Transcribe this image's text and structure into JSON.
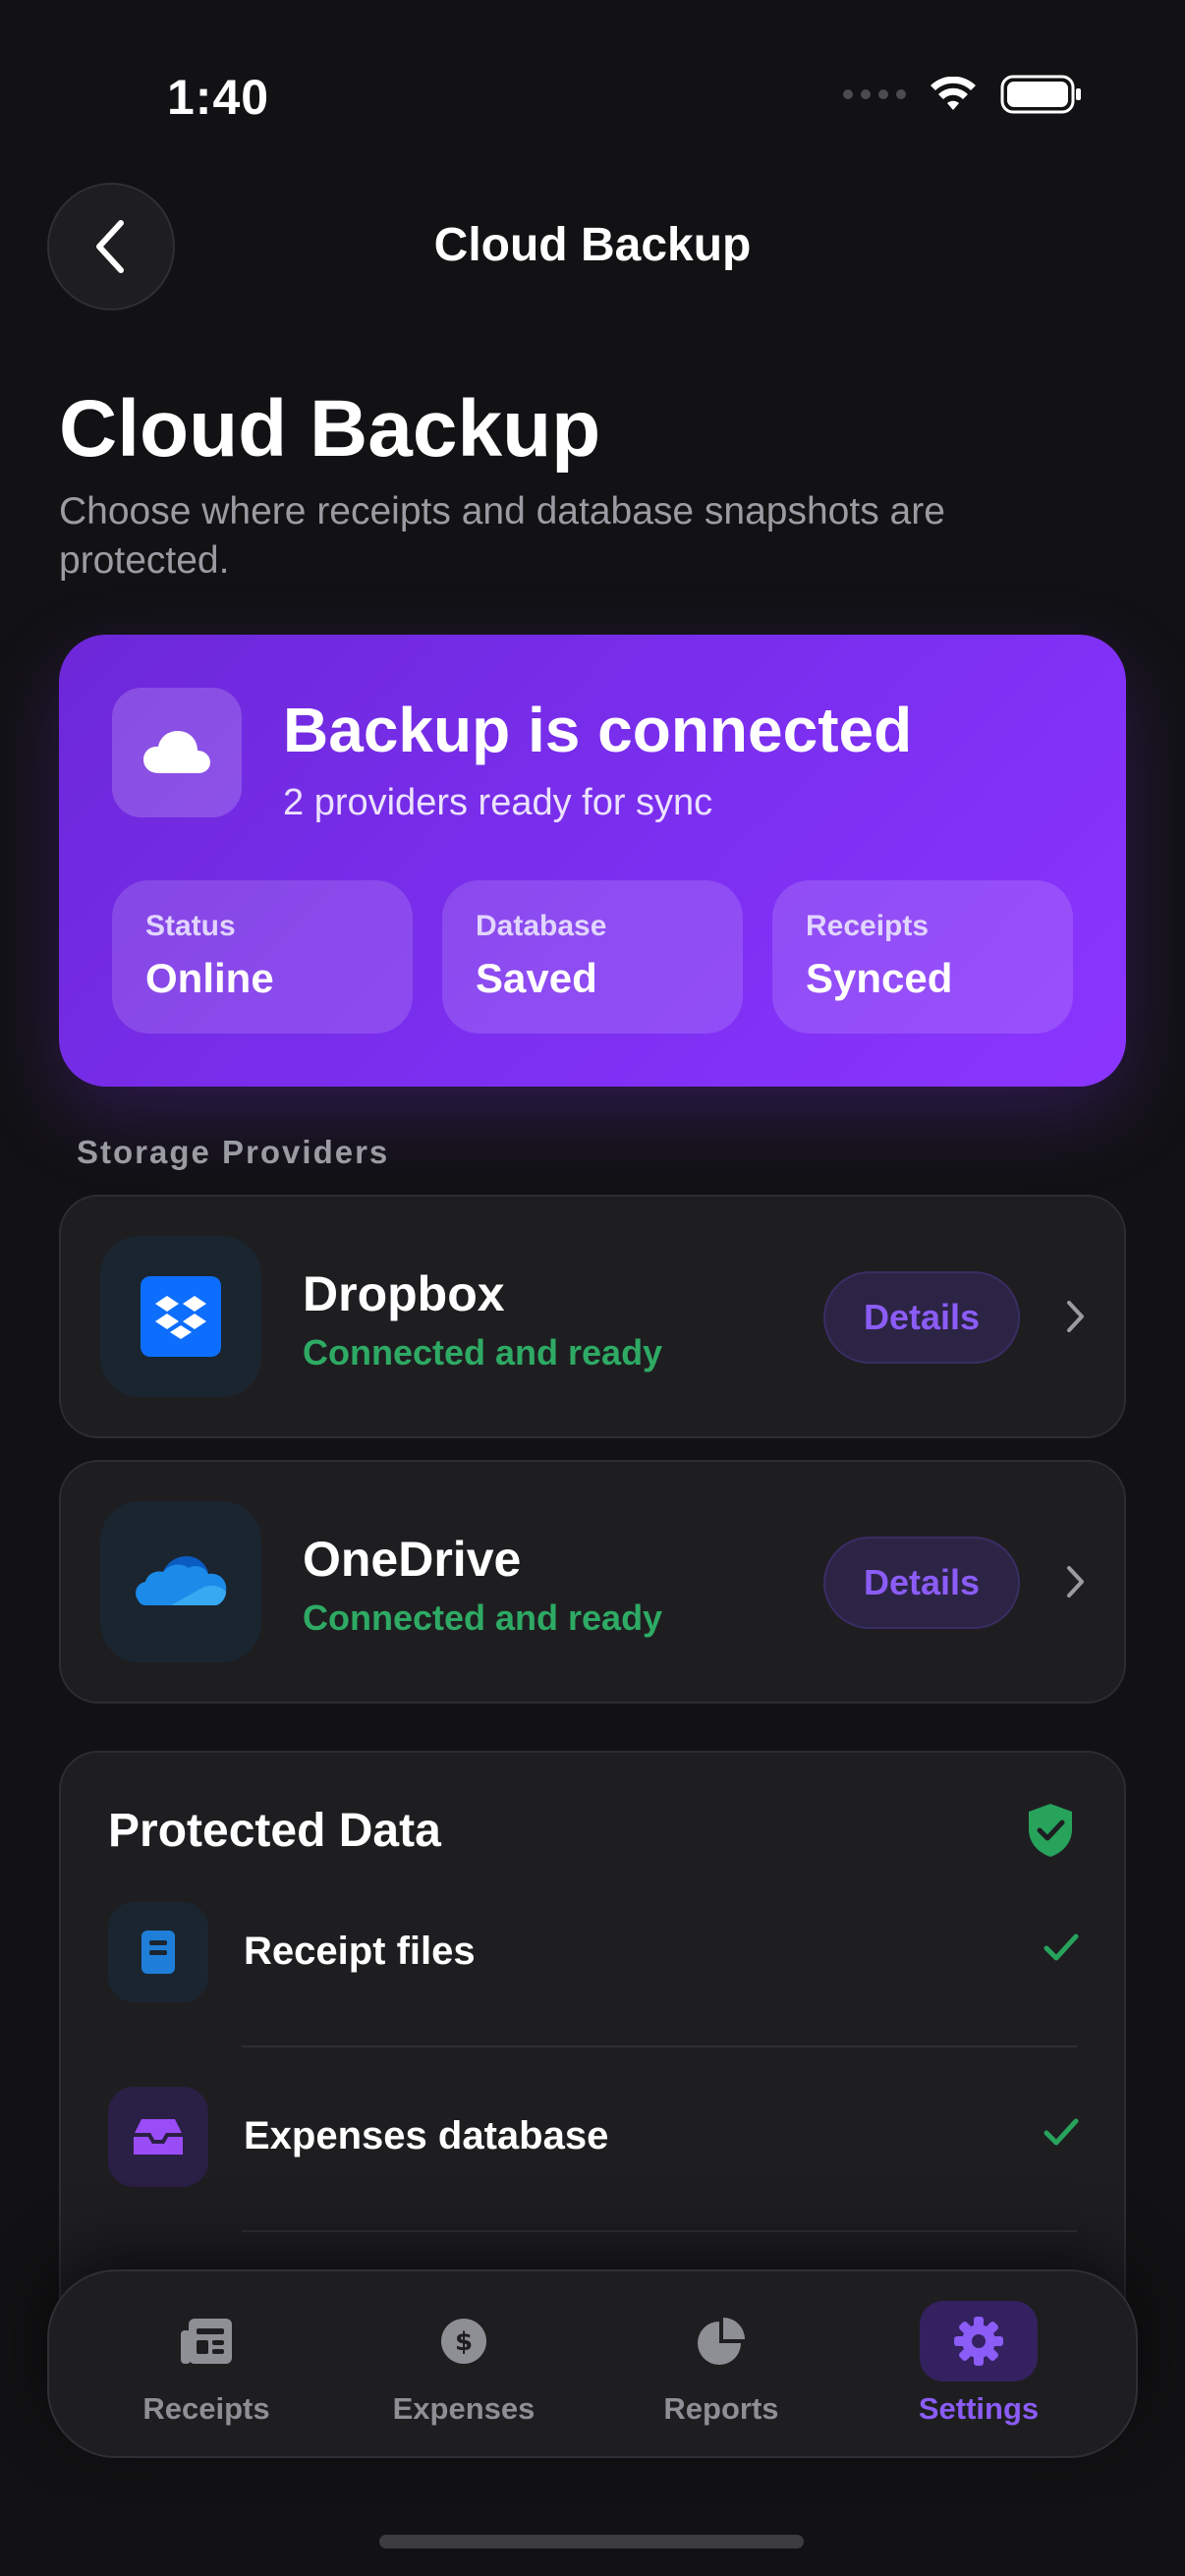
{
  "status_bar": {
    "time": "1:40"
  },
  "nav": {
    "title": "Cloud Backup"
  },
  "header": {
    "title": "Cloud Backup",
    "subtitle": "Choose where receipts and database snapshots are protected."
  },
  "hero": {
    "title": "Backup is connected",
    "subtitle": "2 providers ready for sync",
    "stats": [
      {
        "label": "Status",
        "value": "Online"
      },
      {
        "label": "Database",
        "value": "Saved"
      },
      {
        "label": "Receipts",
        "value": "Synced"
      }
    ]
  },
  "providers_section": {
    "label": "Storage Providers"
  },
  "providers": [
    {
      "name": "Dropbox",
      "status": "Connected and ready",
      "details_label": "Details",
      "icon": "dropbox-icon"
    },
    {
      "name": "OneDrive",
      "status": "Connected and ready",
      "details_label": "Details",
      "icon": "onedrive-icon"
    }
  ],
  "protected": {
    "title": "Protected Data",
    "items": [
      {
        "label": "Receipt files",
        "icon": "receipt-file-icon"
      },
      {
        "label": "Expenses database",
        "icon": "inbox-tray-icon"
      }
    ]
  },
  "tabs": [
    {
      "label": "Receipts",
      "icon": "receipts-icon"
    },
    {
      "label": "Expenses",
      "icon": "dollar-coin-icon"
    },
    {
      "label": "Reports",
      "icon": "pie-chart-icon"
    },
    {
      "label": "Settings",
      "icon": "gear-icon",
      "active": true
    }
  ],
  "colors": {
    "accent": "#7c2ff0",
    "success": "#2eaa64",
    "background": "#121214",
    "card": "#1e1e21"
  }
}
